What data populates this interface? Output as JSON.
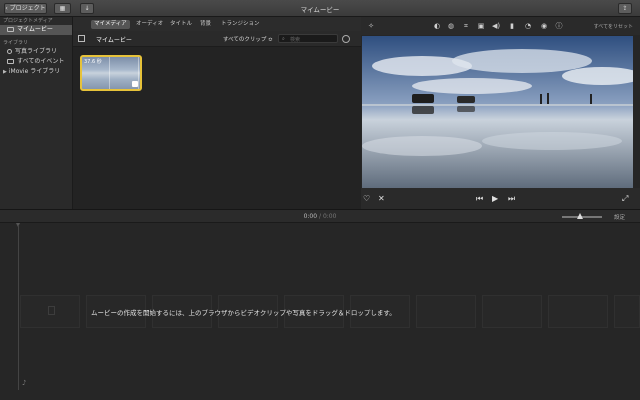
{
  "window": {
    "title": "マイムービー"
  },
  "toolbar": {
    "back_label": "プロジェクト"
  },
  "sidebar": {
    "project_media_header": "プロジェクトメディア",
    "project_item": "マイムービー",
    "libraries_header": "ライブラリ",
    "items": [
      {
        "label": "写真ライブラリ",
        "icon": "photos-icon"
      },
      {
        "label": "すべてのイベント",
        "icon": "events-icon"
      },
      {
        "label": "iMovie ライブラリ",
        "icon": "disclosure-triangle-icon"
      }
    ]
  },
  "browser": {
    "tabs": [
      {
        "label": "マイメディア",
        "active": true
      },
      {
        "label": "オーディオ",
        "active": false
      },
      {
        "label": "タイトル",
        "active": false
      },
      {
        "label": "背景",
        "active": false
      },
      {
        "label": "トランジション",
        "active": false
      }
    ],
    "title": "マイムービー",
    "clip_filter": "すべてのクリップ ≎",
    "search_placeholder": "検索",
    "clip": {
      "duration": "37.6 秒"
    }
  },
  "viewer": {
    "reset_all": "すべてをリセット",
    "tools": [
      "magic-wand-icon",
      "color-balance-icon",
      "color-correction-icon",
      "crop-icon",
      "stabilization-icon",
      "volume-icon",
      "equalizer-icon",
      "speed-icon",
      "filter-icon",
      "info-icon"
    ]
  },
  "timeline": {
    "current_time": "0:00",
    "total_time": "0:00",
    "separator": "/",
    "settings_label": "設定",
    "drop_message": "ムービーの作成を開始するには、上のブラウザからビデオクリップや写真をドラッグ＆ドロップします。",
    "zoom_level": 0.45
  },
  "colors": {
    "accent_yellow": "#e6c23a",
    "background": "#262626"
  }
}
